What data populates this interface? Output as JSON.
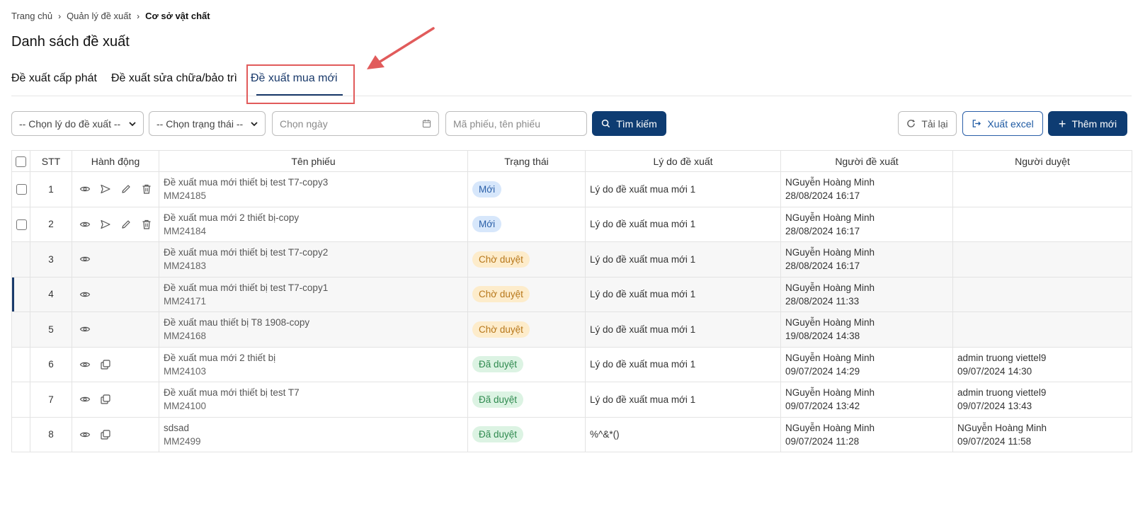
{
  "breadcrumb": {
    "home": "Trang chủ",
    "parent": "Quản lý đề xuất",
    "current": "Cơ sở vật chất"
  },
  "page_title": "Danh sách đề xuất",
  "tabs": [
    {
      "label": "Đề xuất cấp phát"
    },
    {
      "label": "Đề xuất sửa chữa/bảo trì"
    },
    {
      "label": "Đề xuất mua mới",
      "active": true
    }
  ],
  "filters": {
    "reason_select": "-- Chọn lý do đề xuất --",
    "status_select": "-- Chọn trạng thái --",
    "date_placeholder": "Chọn ngày",
    "search_placeholder": "Mã phiếu, tên phiếu",
    "search_button": "Tìm kiếm"
  },
  "toolbar": {
    "reload": "Tải lại",
    "export": "Xuất excel",
    "add": "Thêm mới"
  },
  "table": {
    "headers": [
      "STT",
      "Hành động",
      "Tên phiếu",
      "Trạng thái",
      "Lý do đề xuất",
      "Người đề xuất",
      "Người duyệt"
    ],
    "rows": [
      {
        "stt": "1",
        "name": "Đề xuất mua mới thiết bị test T7-copy3",
        "code": "MM24185",
        "status": "Mới",
        "reason": "Lý do đề xuất mua mới 1",
        "proposer": "NGuyễn Hoàng Minh",
        "proposed_at": "28/08/2024 16:17",
        "approver": "",
        "approved_at": ""
      },
      {
        "stt": "2",
        "name": "Đề xuất mua mới 2 thiết bị-copy",
        "code": "MM24184",
        "status": "Mới",
        "reason": "Lý do đề xuất mua mới 1",
        "proposer": "NGuyễn Hoàng Minh",
        "proposed_at": "28/08/2024 16:17",
        "approver": "",
        "approved_at": ""
      },
      {
        "stt": "3",
        "name": "Đề xuất mua mới thiết bị test T7-copy2",
        "code": "MM24183",
        "status": "Chờ duyệt",
        "reason": "Lý do đề xuất mua mới 1",
        "proposer": "NGuyễn Hoàng Minh",
        "proposed_at": "28/08/2024 16:17",
        "approver": "",
        "approved_at": ""
      },
      {
        "stt": "4",
        "name": "Đề xuất mua mới thiết bị test T7-copy1",
        "code": "MM24171",
        "status": "Chờ duyệt",
        "reason": "Lý do đề xuất mua mới 1",
        "proposer": "NGuyễn Hoàng Minh",
        "proposed_at": "28/08/2024 11:33",
        "approver": "",
        "approved_at": ""
      },
      {
        "stt": "5",
        "name": "Đề xuất mau thiết bị T8 1908-copy",
        "code": "MM24168",
        "status": "Chờ duyệt",
        "reason": "Lý do đề xuất mua mới 1",
        "proposer": "NGuyễn Hoàng Minh",
        "proposed_at": "19/08/2024 14:38",
        "approver": "",
        "approved_at": ""
      },
      {
        "stt": "6",
        "name": "Đề xuất mua mới 2 thiết bị",
        "code": "MM24103",
        "status": "Đã duyệt",
        "reason": "Lý do đề xuất mua mới 1",
        "proposer": "NGuyễn Hoàng Minh",
        "proposed_at": "09/07/2024 14:29",
        "approver": "admin truong viettel9",
        "approved_at": "09/07/2024 14:30"
      },
      {
        "stt": "7",
        "name": "Đề xuất mua mới thiết bị test T7",
        "code": "MM24100",
        "status": "Đã duyệt",
        "reason": "Lý do đề xuất mua mới 1",
        "proposer": "NGuyễn Hoàng Minh",
        "proposed_at": "09/07/2024 13:42",
        "approver": "admin truong viettel9",
        "approved_at": "09/07/2024 13:43"
      },
      {
        "stt": "8",
        "name": "sdsad",
        "code": "MM2499",
        "status": "Đã duyệt",
        "reason": "%^&*()",
        "proposer": "NGuyễn Hoàng Minh",
        "proposed_at": "09/07/2024 11:28",
        "approver": "NGuyễn Hoàng Minh",
        "approved_at": "09/07/2024 11:58"
      }
    ]
  },
  "colors": {
    "primary": "#0e3c72",
    "annotation_red": "#e15b5b",
    "status_new_bg": "#d7e7fb",
    "status_new_fg": "#2a5fa8",
    "status_pending_bg": "#fdeccb",
    "status_pending_fg": "#b7771a",
    "status_approved_bg": "#dcf3e3",
    "status_approved_fg": "#2f8a4f"
  }
}
